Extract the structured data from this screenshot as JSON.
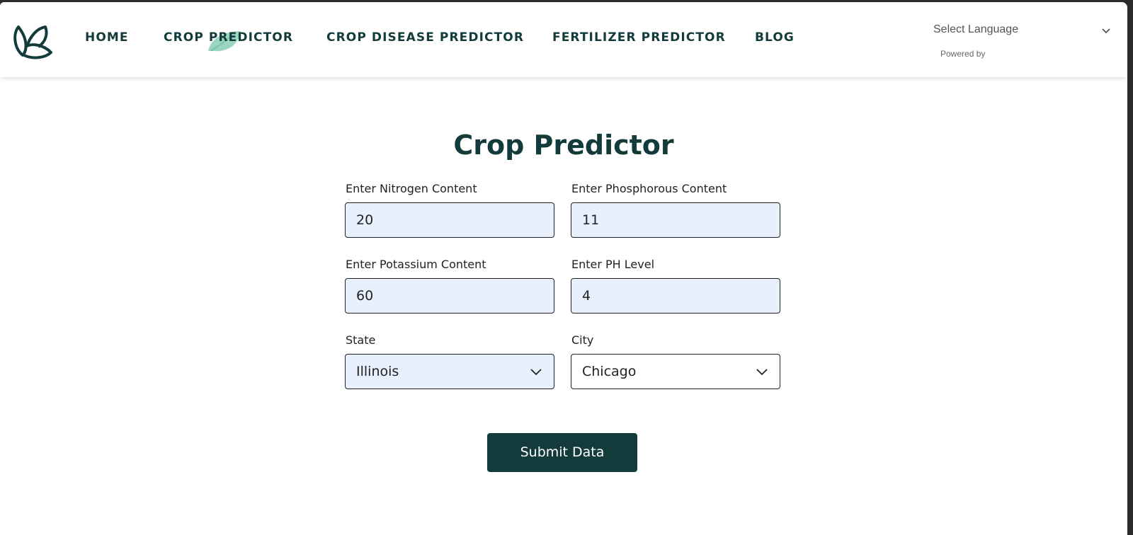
{
  "nav": {
    "items": [
      {
        "label": "HOME"
      },
      {
        "label": "CROP PREDICTOR"
      },
      {
        "label": "CROP DISEASE PREDICTOR"
      },
      {
        "label": "FERTILIZER PREDICTOR"
      },
      {
        "label": "BLOG"
      }
    ],
    "active_index": 1,
    "language_select": "Select Language",
    "powered_by": "Powered by"
  },
  "colors": {
    "primary": "#133b3b",
    "input_filled_bg": "#e8f0fe",
    "leaf_accent": "#8fd1b8"
  },
  "icons": {
    "logo": "leaf-logo-icon",
    "active_marker": "leaf-icon",
    "dropdown": "chevron-down-icon"
  },
  "form": {
    "title": "Crop Predictor",
    "nitrogen": {
      "label": "Enter Nitrogen Content",
      "value": "20"
    },
    "phosphorous": {
      "label": "Enter Phosphorous Content",
      "value": "11"
    },
    "potassium": {
      "label": "Enter Potassium Content",
      "value": "60"
    },
    "ph": {
      "label": "Enter PH Level",
      "value": "4"
    },
    "state": {
      "label": "State",
      "value": "Illinois"
    },
    "city": {
      "label": "City",
      "value": "Chicago"
    },
    "submit_label": "Submit Data"
  }
}
